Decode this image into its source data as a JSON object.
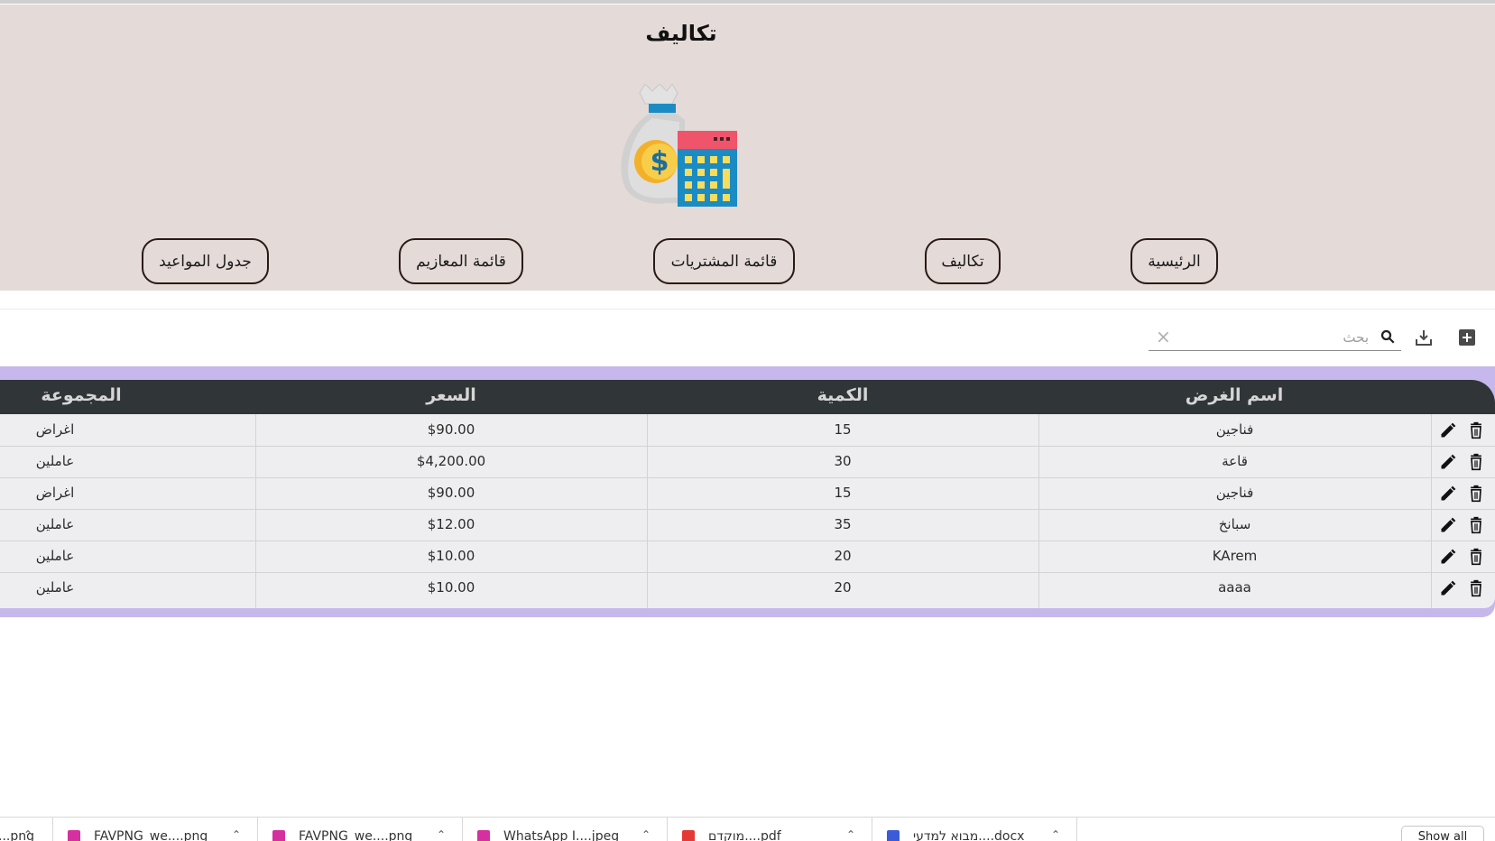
{
  "header": {
    "title": "تكاليف",
    "icon": "money-bag-calculator-icon"
  },
  "nav": [
    {
      "label": "الرئيسية"
    },
    {
      "label": "تكاليف"
    },
    {
      "label": "قائمة المشتريات"
    },
    {
      "label": "قائمة المعازيم"
    },
    {
      "label": "جدول المواعيد"
    }
  ],
  "toolbar": {
    "add_icon": "add-box-icon",
    "download_icon": "download-icon",
    "search_placeholder": "بحث",
    "search_value": "",
    "clear_symbol": "×"
  },
  "table": {
    "columns": [
      "اسم الغرض",
      "الكمية",
      "السعر",
      "المجموعة"
    ],
    "rows": [
      [
        "فناجين",
        "15",
        "$90.00",
        "اغراض"
      ],
      [
        "قاعة",
        "30",
        "$4,200.00",
        "عاملين"
      ],
      [
        "فناجين",
        "15",
        "$90.00",
        "اغراض"
      ],
      [
        "سبانخ",
        "35",
        "$12.00",
        "عاملين"
      ],
      [
        "KArem",
        "20",
        "$10.00",
        "عاملين"
      ],
      [
        "aaaa",
        "20",
        "$10.00",
        "عاملين"
      ]
    ],
    "row_actions": [
      "edit-icon",
      "delete-icon"
    ],
    "header_bg": "#303638",
    "frame_color": "#c6b8ec"
  },
  "downloads": {
    "items": [
      {
        "name": "...png",
        "color": "#888888"
      },
      {
        "name": "FAVPNG_we....png",
        "color": "#d62fa0"
      },
      {
        "name": "FAVPNG_we....png",
        "color": "#d62fa0"
      },
      {
        "name": "WhatsApp I....jpeg",
        "color": "#d62fa0"
      },
      {
        "name": "מוקדם....pdf",
        "color": "#e53935"
      },
      {
        "name": "מבוא למדעי....docx",
        "color": "#3b5bd9"
      }
    ],
    "show_all": "Show all"
  }
}
